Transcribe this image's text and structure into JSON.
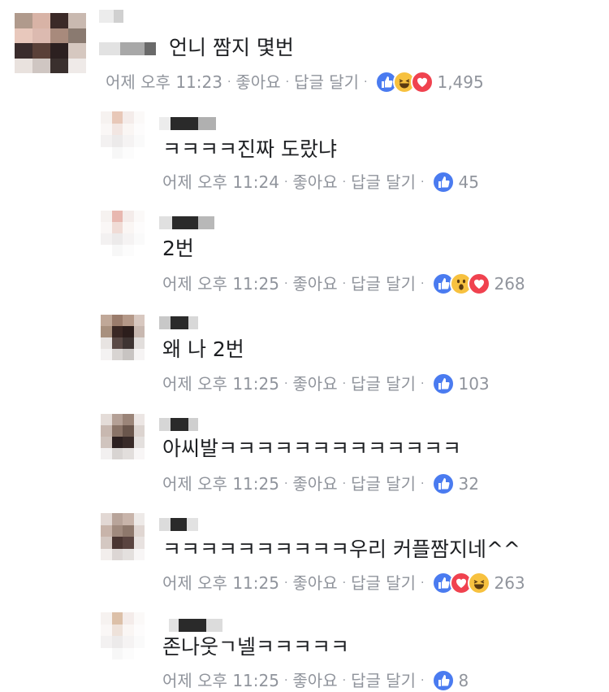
{
  "actions": {
    "like": "좋아요",
    "reply": "답글 달기",
    "sep": "·"
  },
  "colors": {
    "like": "#4a7bf0",
    "haha": "#f7c13f",
    "love": "#f0424f",
    "wow": "#f7c13f",
    "meta": "#90949c"
  },
  "comments": [
    {
      "text": "언니 짬지 몇번",
      "time": "어제 오후 11:23",
      "reactions": [
        "like-icon",
        "haha-icon",
        "love-icon"
      ],
      "count": "1,495"
    },
    {
      "text": "ㅋㅋㅋㅋ진짜 도랐냐",
      "time": "어제 오후 11:24",
      "reactions": [
        "like-icon"
      ],
      "count": "45"
    },
    {
      "text": "2번",
      "time": "어제 오후 11:25",
      "reactions": [
        "like-icon",
        "wow-icon",
        "love-icon"
      ],
      "count": "268"
    },
    {
      "text": "왜 나 2번",
      "time": "어제 오후 11:25",
      "reactions": [
        "like-icon"
      ],
      "count": "103"
    },
    {
      "text": "아씨발ㅋㅋㅋㅋㅋㅋㅋㅋㅋㅋㅋㅋㅋ",
      "time": "어제 오후 11:25",
      "reactions": [
        "like-icon"
      ],
      "count": "32"
    },
    {
      "text": "ㅋㅋㅋㅋㅋㅋㅋㅋㅋㅋ우리 커플짬지네^^",
      "time": "어제 오후 11:25",
      "reactions": [
        "like-icon",
        "love-icon",
        "haha-icon"
      ],
      "count": "263"
    },
    {
      "text": "존나웃ㄱ넬ㅋㅋㅋㅋㅋ",
      "time": "어제 오후 11:25",
      "reactions": [
        "like-icon"
      ],
      "count": "8"
    }
  ]
}
